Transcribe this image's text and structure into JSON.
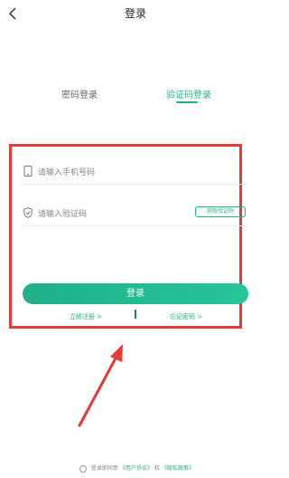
{
  "header": {
    "title": "登录",
    "back_icon": "chevron-left-icon"
  },
  "tabs": [
    {
      "label": "密码登录",
      "active": false
    },
    {
      "label": "验证码登录",
      "active": true
    }
  ],
  "form": {
    "phone": {
      "placeholder": "请输入手机号码",
      "icon": "phone-icon"
    },
    "code": {
      "placeholder": "请输入验证码",
      "icon": "shield-icon"
    },
    "get_code_label": "获取验证码",
    "login_label": "登录"
  },
  "links": {
    "register": "立即注册 >",
    "forgot": "忘记密码 >"
  },
  "agreement": {
    "prefix": "登录即同意",
    "user_agreement": "《用户协议》",
    "and": "和",
    "privacy_policy": "《隐私政策》"
  },
  "colors": {
    "accent": "#21b483",
    "annotation": "#e53a3a"
  }
}
